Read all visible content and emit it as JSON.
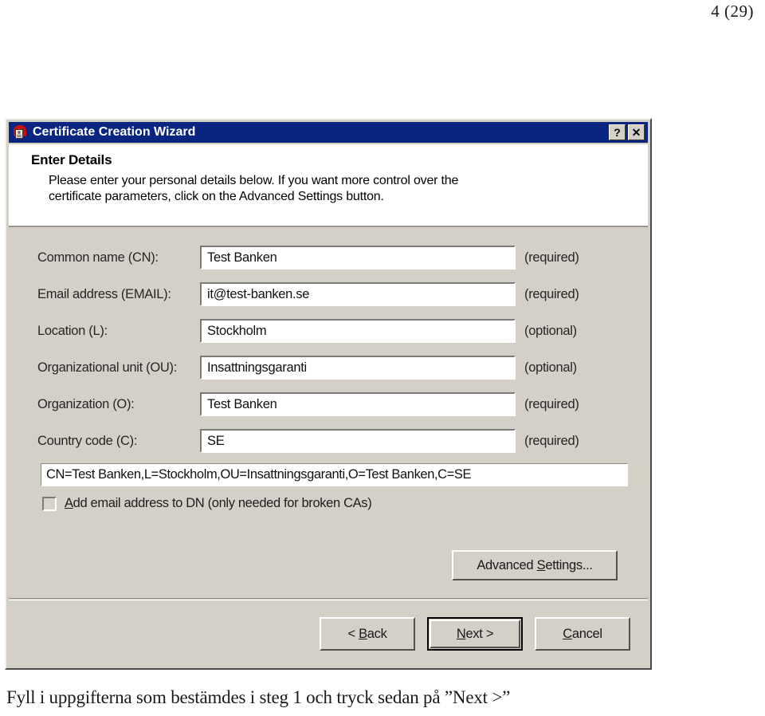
{
  "page": {
    "page_number": "4 (29)",
    "caption": "Fyll i uppgifterna som bestämdes i steg 1 och tryck sedan på ”Next >”"
  },
  "dialog": {
    "title": "Certificate Creation Wizard",
    "icon": "certificate-icon",
    "titlebar_buttons": [
      {
        "name": "help-button",
        "glyph": "?"
      },
      {
        "name": "close-button",
        "glyph": "✕"
      }
    ],
    "banner": {
      "heading": "Enter Details",
      "body_line1": "Please enter your personal details below. If you want more control over the",
      "body_line2": "certificate parameters, click on the Advanced Settings button."
    },
    "fields": [
      {
        "label": "Common name (CN):",
        "value": "Test Banken",
        "note": "(required)"
      },
      {
        "label": "Email address (EMAIL):",
        "value": "it@test-banken.se",
        "note": "(required)"
      },
      {
        "label": "Location (L):",
        "value": "Stockholm",
        "note": "(optional)"
      },
      {
        "label": "Organizational unit (OU):",
        "value": "Insattningsgaranti",
        "note": "(optional)"
      },
      {
        "label": "Organization (O):",
        "value": "Test Banken",
        "note": "(required)"
      },
      {
        "label": "Country code (C):",
        "value": "SE",
        "note": "(required)"
      }
    ],
    "dn_summary": "CN=Test Banken,L=Stockholm,OU=Insattningsgaranti,O=Test Banken,C=SE",
    "checkbox": {
      "checked": false,
      "label_accel": "A",
      "label_rest": "dd email address to DN (only needed for broken CAs)"
    },
    "advanced_button": "Advanced Settings...",
    "nav_buttons": {
      "back_prefix": "< ",
      "back_accel": "B",
      "back_rest": "ack",
      "next_accel": "N",
      "next_rest": "ext >",
      "cancel_accel": "C",
      "cancel_rest": "ancel"
    }
  },
  "colors": {
    "titlebar": "#0a2580",
    "face": "#d4d0c8",
    "banner": "#ffffff",
    "icon_red": "#c41212"
  }
}
